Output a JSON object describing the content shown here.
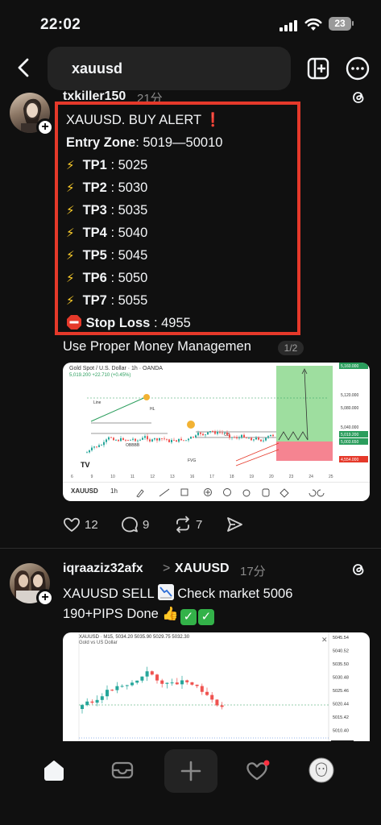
{
  "status": {
    "time": "22:02",
    "battery": "23"
  },
  "search": {
    "query": "xauusd"
  },
  "post1": {
    "username": "txkiller150",
    "time": "21分",
    "alert_title": "XAUUSD. BUY ALERT",
    "alert_mark": "❗",
    "entry_label": "Entry Zone",
    "entry_value": ": 5019—50010",
    "targets": [
      {
        "label": "TP1",
        "value": ": 5025"
      },
      {
        "label": "TP2",
        "value": ": 5030"
      },
      {
        "label": "TP3",
        "value": ": 5035"
      },
      {
        "label": "TP4",
        "value": ": 5040"
      },
      {
        "label": "TP5",
        "value": ": 5045"
      },
      {
        "label": "TP6",
        "value": ": 5050"
      },
      {
        "label": "TP7",
        "value": ": 5055"
      }
    ],
    "stop_label": "Stop Loss",
    "stop_value": ": 4955",
    "caption": "Use Proper Money Managemen",
    "page": "1/2",
    "chart": {
      "title": "Gold Spot / U.S. Dollar · 1h · OANDA",
      "change": "5,019.200 +22.710 (+0.45%)",
      "symbol": "XAUUSD",
      "timeframe": "1h",
      "price_labels": [
        "5,160.000",
        "5,120.000",
        "5,080.000",
        "5,040.000",
        "5,019.200",
        "5,003.650",
        "4,554.000"
      ],
      "date_labels": [
        "6",
        "9",
        "10",
        "11",
        "12",
        "13",
        "16",
        "17",
        "18",
        "19",
        "20",
        "23",
        "24",
        "25"
      ],
      "annotations": [
        "Line",
        "HL",
        "OBBBB",
        "OB",
        "FVG"
      ]
    },
    "likes": "12",
    "comments": "9",
    "reposts": "7"
  },
  "post2": {
    "username": "iqraaziz32afx",
    "chevron": ">",
    "tag": "XAUUSD",
    "time": "17分",
    "line1_a": "XAUUSD SELL",
    "line1_b": "Check market 5006",
    "line2": "190+PIPS Done",
    "chart": {
      "title": "XAUUSD · M15, 5034.20 5035.90 5029.75 5032.30",
      "subtitle": "Gold vs US Dollar",
      "price_labels": [
        "5045.54",
        "5040.52",
        "5035.50",
        "5030.48",
        "5025.46",
        "5020.44",
        "5015.42",
        "5010.40",
        "5006.91"
      ]
    }
  }
}
